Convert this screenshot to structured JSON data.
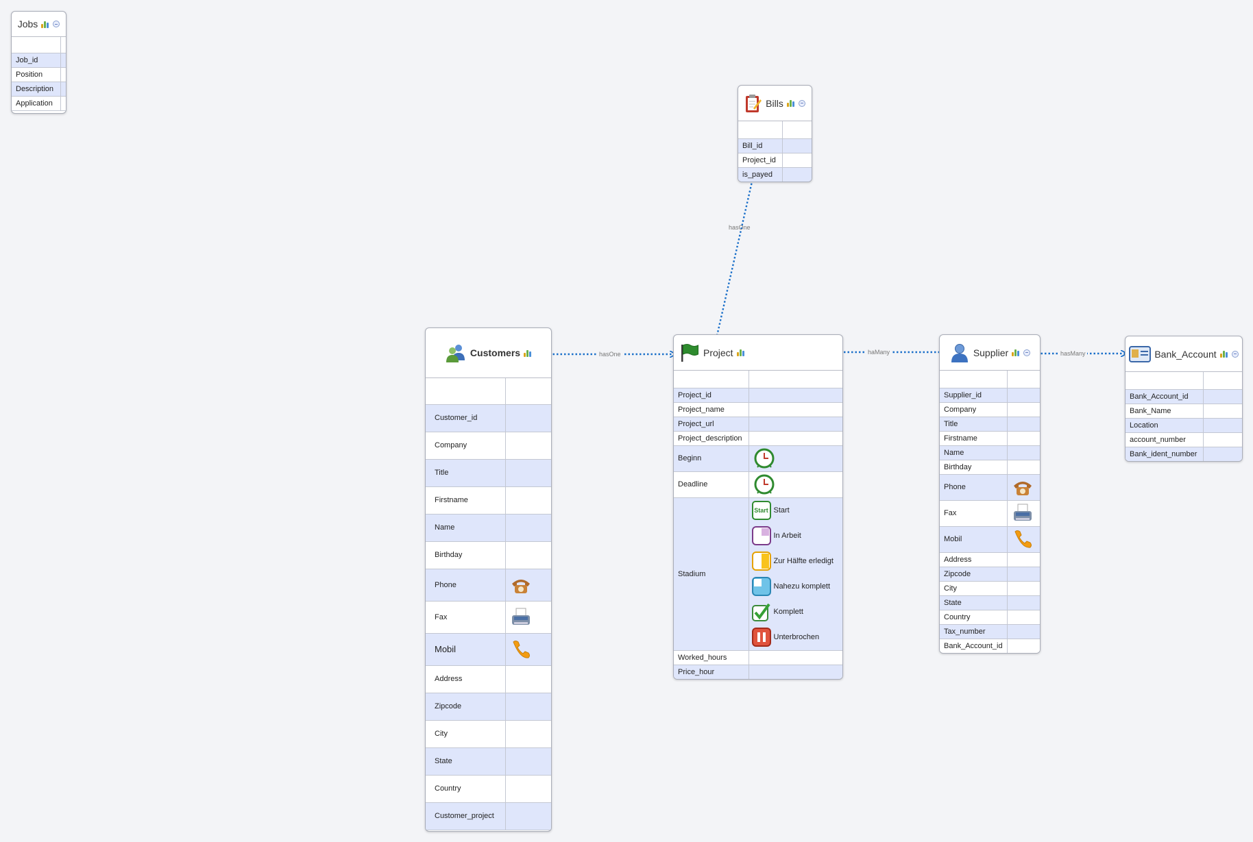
{
  "colors": {
    "link": "#1a6fc9",
    "row_blue": "#dfe6fb",
    "row_white": "#ffffff",
    "background": "#f3f4f7"
  },
  "tables": {
    "jobs": {
      "title": "Jobs",
      "icon": "chart-icon",
      "rows": [
        {
          "label": "Job_id"
        },
        {
          "label": "Position"
        },
        {
          "label": "Description"
        },
        {
          "label": "Application"
        }
      ]
    },
    "bills": {
      "title": "Bills",
      "icon": "clipboard-icon",
      "rows": [
        {
          "label": "Bill_id"
        },
        {
          "label": "Project_id"
        },
        {
          "label": "is_payed"
        }
      ]
    },
    "customers": {
      "title": "Customers",
      "icon": "users-icon",
      "rows": [
        {
          "label": "Customer_id"
        },
        {
          "label": "Company"
        },
        {
          "label": "Title"
        },
        {
          "label": "Firstname"
        },
        {
          "label": "Name"
        },
        {
          "label": "Birthday"
        },
        {
          "label": "Phone",
          "icon": "telephone-icon"
        },
        {
          "label": "Fax",
          "icon": "fax-icon"
        },
        {
          "label": "Mobil",
          "icon": "mobile-phone-icon"
        },
        {
          "label": "Address"
        },
        {
          "label": "Zipcode"
        },
        {
          "label": "City"
        },
        {
          "label": "State"
        },
        {
          "label": "Country"
        },
        {
          "label": "Customer_project"
        }
      ]
    },
    "project": {
      "title": "Project",
      "icon": "flag-icon",
      "rows": [
        {
          "label": "Project_id"
        },
        {
          "label": "Project_name"
        },
        {
          "label": "Project_url"
        },
        {
          "label": "Project_description"
        },
        {
          "label": "Beginn",
          "icon": "clock-icon"
        },
        {
          "label": "Deadline",
          "icon": "clock-icon"
        },
        {
          "label": "Stadium"
        },
        {
          "label": "Worked_hours"
        },
        {
          "label": "Price_hour"
        }
      ],
      "stadium_options": [
        {
          "icon": "start-icon",
          "label": "Start"
        },
        {
          "icon": "in-progress-icon",
          "label": "In Arbeit"
        },
        {
          "icon": "half-done-icon",
          "label": "Zur Hälfte erledigt"
        },
        {
          "icon": "almost-done-icon",
          "label": "Nahezu komplett"
        },
        {
          "icon": "checkmark-icon",
          "label": "Komplett"
        },
        {
          "icon": "pause-icon",
          "label": "Unterbrochen"
        }
      ],
      "start_icon_text": "Start"
    },
    "supplier": {
      "title": "Supplier",
      "icon": "person-icon",
      "rows": [
        {
          "label": "Supplier_id"
        },
        {
          "label": "Company"
        },
        {
          "label": "Title"
        },
        {
          "label": "Firstname"
        },
        {
          "label": "Name"
        },
        {
          "label": "Birthday"
        },
        {
          "label": "Phone",
          "icon": "telephone-icon"
        },
        {
          "label": "Fax",
          "icon": "fax-icon"
        },
        {
          "label": "Mobil",
          "icon": "mobile-phone-icon"
        },
        {
          "label": "Address"
        },
        {
          "label": "Zipcode"
        },
        {
          "label": "City"
        },
        {
          "label": "State"
        },
        {
          "label": "Country"
        },
        {
          "label": "Tax_number"
        },
        {
          "label": "Bank_Account_id"
        }
      ]
    },
    "bank_account": {
      "title": "Bank_Account",
      "icon": "id-card-icon",
      "rows": [
        {
          "label": "Bank_Account_id"
        },
        {
          "label": "Bank_Name"
        },
        {
          "label": "Location"
        },
        {
          "label": "account_number"
        },
        {
          "label": "Bank_ident_number"
        }
      ]
    }
  },
  "relations": [
    {
      "from": "Project",
      "to": "Bills",
      "label": "hasOne"
    },
    {
      "from": "Customers",
      "to": "Project",
      "label": "hasOne"
    },
    {
      "from": "Supplier",
      "to": "Project",
      "label": "haMany"
    },
    {
      "from": "Supplier",
      "to": "Bank_Account",
      "label": "hasMany"
    }
  ]
}
